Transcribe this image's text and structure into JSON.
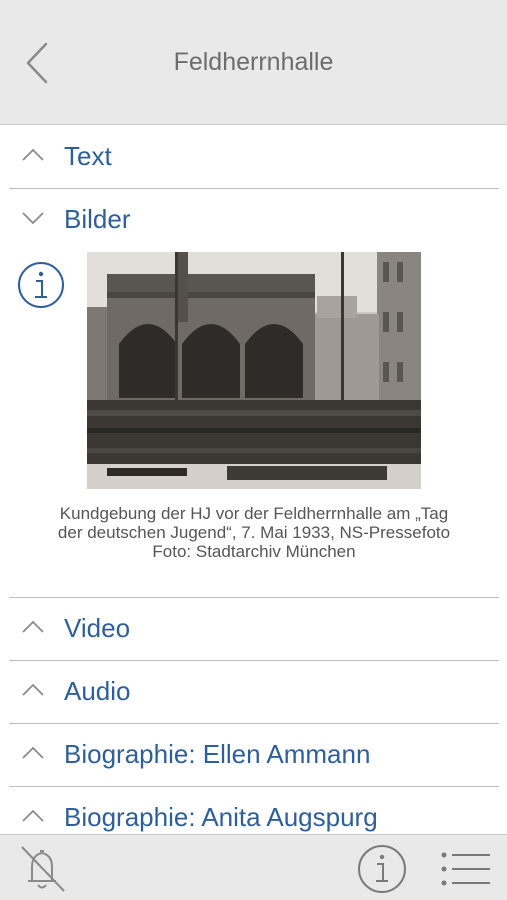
{
  "header": {
    "title": "Feldherrnhalle"
  },
  "sections": {
    "text": "Text",
    "bilder": "Bilder",
    "video": "Video",
    "audio": "Audio",
    "bio1": "Biographie: Ellen Ammann",
    "bio2": "Biographie: Anita Augspurg"
  },
  "image": {
    "caption_line1": "Kundgebung der HJ vor der Feldherrnhalle am „Tag",
    "caption_line2": "der deutschen Jugend“, 7. Mai 1933, NS-Pressefoto",
    "caption_line3": "Foto: Stadtarchiv München"
  },
  "icons": {
    "back": "chevron-left-icon",
    "collapsed": "chevron-up-icon",
    "expanded": "chevron-down-icon",
    "info": "info-icon",
    "bell_off": "bell-off-icon",
    "list": "list-icon"
  },
  "colors": {
    "accent": "#2f5f9a",
    "bar": "#e9e9e9",
    "divider": "#bdbdbd"
  }
}
